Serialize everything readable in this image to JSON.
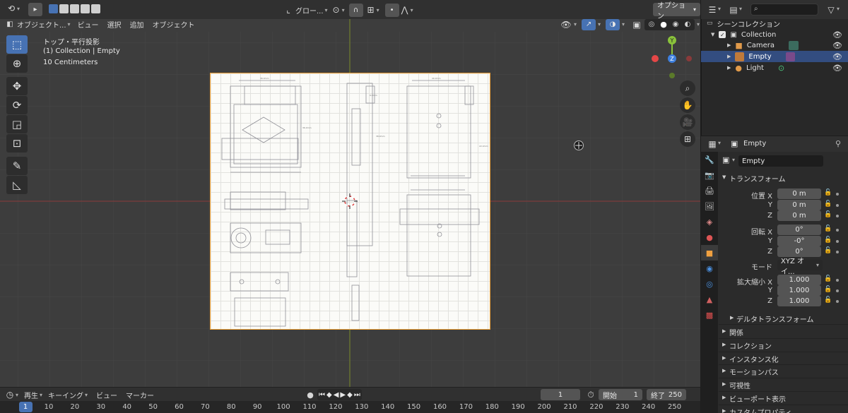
{
  "viewport": {
    "header": {
      "mode_label": "オブジェクト...",
      "menus": [
        "ビュー",
        "選択",
        "追加",
        "オブジェクト"
      ],
      "transform_orientation": "グロー...",
      "options_label": "オプション"
    },
    "overlay": {
      "view_name": "トップ・平行投影",
      "collection_info": "(1) Collection | Empty",
      "scale_info": "10 Centimeters"
    },
    "gizmo": {
      "y_label": "Y",
      "z_label": "Z",
      "x_color": "#e54747",
      "y_color": "#8ac33b",
      "z_color": "#3e80df"
    }
  },
  "timeline": {
    "playback_label": "再生",
    "keying_label": "キーイング",
    "view_label": "ビュー",
    "marker_label": "マーカー",
    "current_frame": "1",
    "start_label": "開始",
    "start_value": "1",
    "end_label": "終了",
    "end_value": "250",
    "frame_labels": [
      "1",
      "10",
      "20",
      "30",
      "40",
      "50",
      "60",
      "70",
      "80",
      "90",
      "100",
      "110",
      "120",
      "130",
      "140",
      "150",
      "160",
      "170",
      "180",
      "190",
      "200",
      "210",
      "220",
      "230",
      "240",
      "250"
    ]
  },
  "outliner": {
    "search_placeholder": "",
    "root_label": "シーンコレクション",
    "collection_label": "Collection",
    "items": [
      {
        "label": "Camera"
      },
      {
        "label": "Empty"
      },
      {
        "label": "Light"
      }
    ]
  },
  "properties": {
    "header_object": "Empty",
    "object_name": "Empty",
    "transform_title": "トランスフォーム",
    "location_label": "位置 X",
    "location": [
      "0 m",
      "0 m",
      "0 m"
    ],
    "rotation_label": "回転 X",
    "rotation": [
      "0°",
      "-0°",
      "0°"
    ],
    "mode_label": "モード",
    "mode_value": "XYZ オイ...",
    "scale_label": "拡大縮小 X",
    "scale": [
      "1.000",
      "1.000",
      "1.000"
    ],
    "axis_y": "Y",
    "axis_z": "Z",
    "delta_title": "デルタトランスフォーム",
    "panels": [
      "関係",
      "コレクション",
      "インスタンス化",
      "モーションパス",
      "可視性",
      "ビューポート表示",
      "カスタムプロパティ"
    ]
  }
}
